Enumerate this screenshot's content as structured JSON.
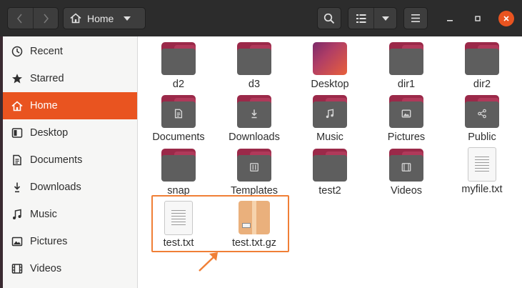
{
  "header": {
    "path_label": "Home",
    "icons": {
      "back": "chevron-left-icon",
      "forward": "chevron-right-icon",
      "home": "home-icon",
      "search": "search-icon",
      "list_view": "list-view-icon",
      "view_options": "caret-down-icon",
      "menu": "hamburger-menu-icon",
      "minimize": "minimize-icon",
      "maximize": "maximize-icon",
      "close": "close-icon"
    }
  },
  "sidebar": {
    "items": [
      {
        "label": "Recent",
        "icon": "clock-icon"
      },
      {
        "label": "Starred",
        "icon": "star-icon"
      },
      {
        "label": "Home",
        "icon": "home-icon",
        "active": true
      },
      {
        "label": "Desktop",
        "icon": "desktop-icon"
      },
      {
        "label": "Documents",
        "icon": "document-icon"
      },
      {
        "label": "Downloads",
        "icon": "download-icon"
      },
      {
        "label": "Music",
        "icon": "music-icon"
      },
      {
        "label": "Pictures",
        "icon": "picture-icon"
      },
      {
        "label": "Videos",
        "icon": "video-icon"
      }
    ]
  },
  "files": [
    {
      "name": "d2",
      "kind": "folder"
    },
    {
      "name": "d3",
      "kind": "folder"
    },
    {
      "name": "Desktop",
      "kind": "desktop-folder"
    },
    {
      "name": "dir1",
      "kind": "folder"
    },
    {
      "name": "dir2",
      "kind": "folder"
    },
    {
      "name": "Documents",
      "kind": "folder",
      "emblem": "document-icon"
    },
    {
      "name": "Downloads",
      "kind": "folder",
      "emblem": "download-icon"
    },
    {
      "name": "Music",
      "kind": "folder",
      "emblem": "music-icon"
    },
    {
      "name": "Pictures",
      "kind": "folder",
      "emblem": "picture-icon"
    },
    {
      "name": "Public",
      "kind": "folder",
      "emblem": "share-icon"
    },
    {
      "name": "snap",
      "kind": "folder"
    },
    {
      "name": "Templates",
      "kind": "folder",
      "emblem": "template-icon"
    },
    {
      "name": "test2",
      "kind": "folder"
    },
    {
      "name": "Videos",
      "kind": "folder",
      "emblem": "film-icon"
    },
    {
      "name": "myfile.txt",
      "kind": "text-file"
    },
    {
      "name": "test.txt",
      "kind": "text-file"
    },
    {
      "name": "test.txt.gz",
      "kind": "archive"
    }
  ],
  "colors": {
    "accent": "#e95420",
    "headerbar": "#2c2c2c",
    "folder_tab": "#9b2949",
    "folder_body": "#5e5e5e",
    "annotation": "#f07f36"
  }
}
